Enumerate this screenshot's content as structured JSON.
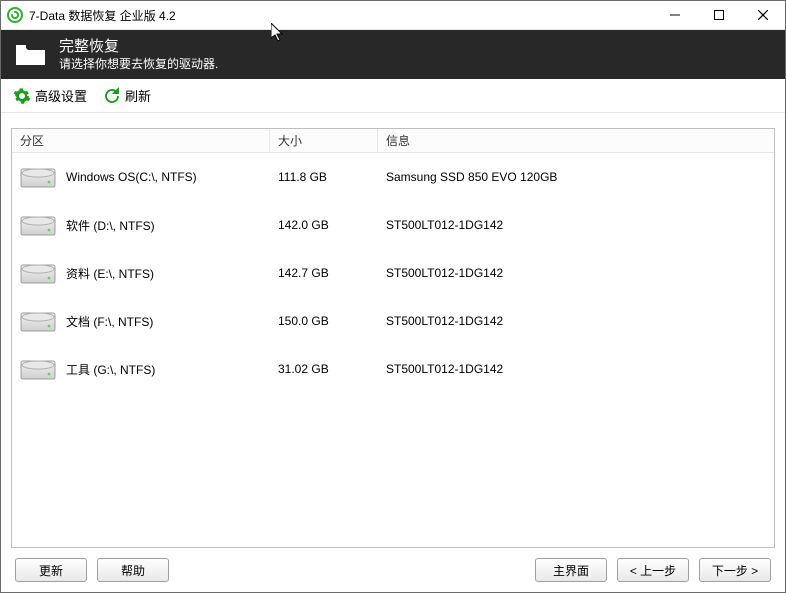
{
  "window": {
    "title": "7-Data 数据恢复 企业版 4.2"
  },
  "banner": {
    "title": "完整恢复",
    "subtitle": "请选择你想要去恢复的驱动器."
  },
  "toolbar": {
    "advanced_label": "高级设置",
    "refresh_label": "刷新"
  },
  "columns": {
    "partition": "分区",
    "size": "大小",
    "info": "信息"
  },
  "drives": [
    {
      "name": "Windows OS(C:\\, NTFS)",
      "size": "111.8 GB",
      "info": "Samsung SSD 850 EVO 120GB"
    },
    {
      "name": "软件 (D:\\, NTFS)",
      "size": "142.0 GB",
      "info": "ST500LT012-1DG142"
    },
    {
      "name": "资料 (E:\\, NTFS)",
      "size": "142.7 GB",
      "info": "ST500LT012-1DG142"
    },
    {
      "name": "文档 (F:\\, NTFS)",
      "size": "150.0 GB",
      "info": "ST500LT012-1DG142"
    },
    {
      "name": "工具 (G:\\, NTFS)",
      "size": "31.02 GB",
      "info": "ST500LT012-1DG142"
    }
  ],
  "buttons": {
    "update": "更新",
    "help": "帮助",
    "main": "主界面",
    "prev": "< 上一步",
    "next": "下一步 >"
  }
}
